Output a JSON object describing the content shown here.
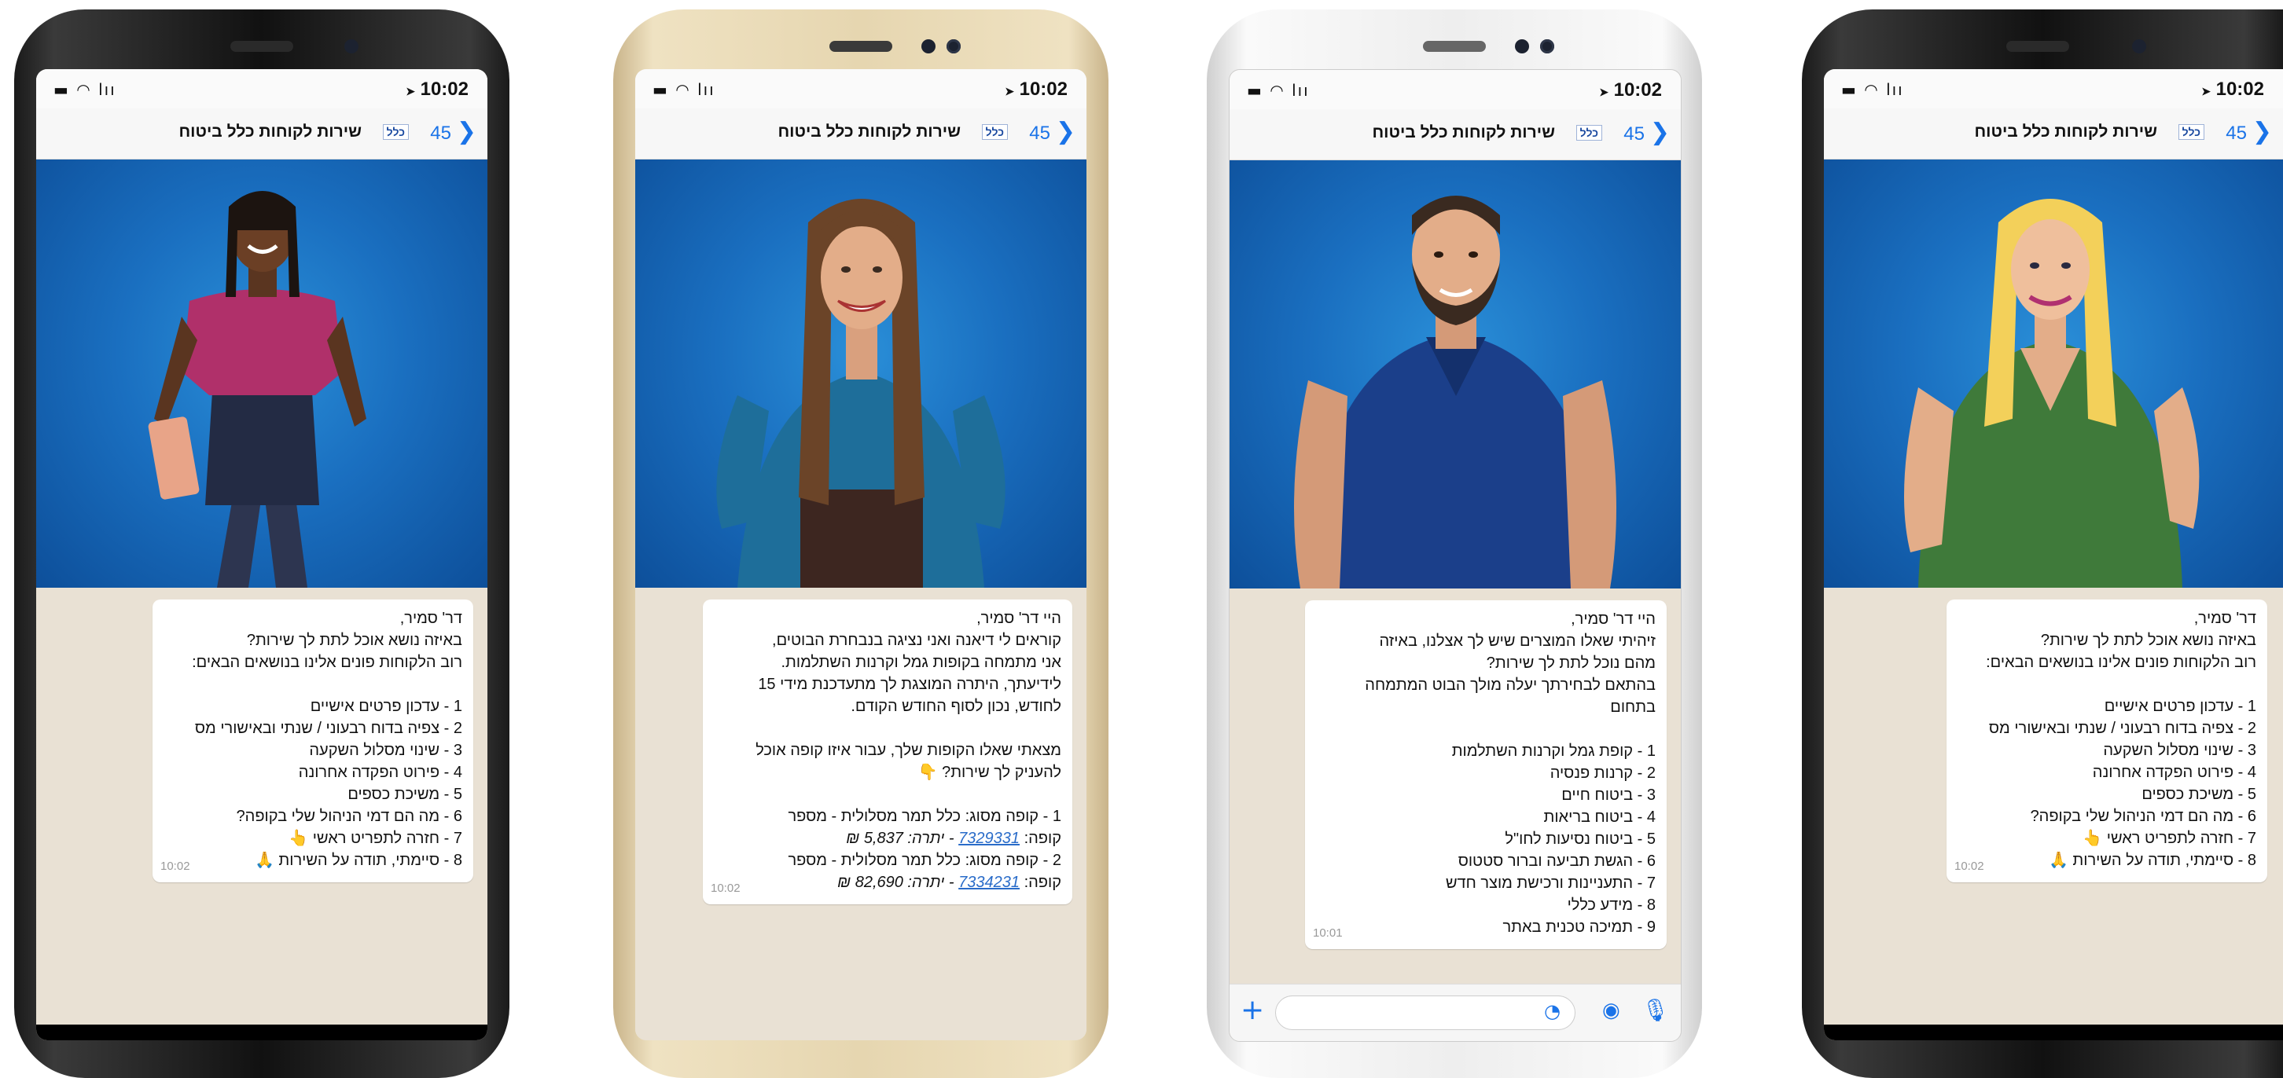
{
  "common": {
    "status_left": "▬ ◠ lıı",
    "time": "10:02",
    "location_arrow": "➤",
    "back_chevron": "❯",
    "unread_count": "45",
    "brand_logo": "כלל",
    "chat_title": "שירות לקוחות כלל ביטוח",
    "msg_time": "10:02",
    "msg_time_3": "10:01"
  },
  "phone1": {
    "lines": [
      "דר' סמיר,",
      "באיזה נושא אוכל לתת לך שירות?",
      "רוב הלקוחות פונים אלינו בנושאים הבאים:",
      "",
      "1 - עדכון פרטים אישיים",
      "2 - צפיה בדוח רבעוני / שנתי ובאישורי מס",
      "3 - שינוי מסלול השקעה",
      "4 - פירוט הפקדה אחרונה",
      "5 - משיכת כספים",
      "6 - מה הם דמי הניהול שלי בקופה?",
      "7 - חזרה לתפריט ראשי 👆",
      "8 - סיימתי, תודה על השירות 🙏"
    ]
  },
  "phone2": {
    "lines": [
      "היי דר' סמיר,",
      "קוראים לי דיאנה ואני נציגה בנבחרת הבוטים,",
      "אני מתמחה בקופות גמל וקרנות השתלמות.",
      "לידיעתך, היתרה המוצגת לך מתעדכנת מידי 15",
      "לחודש, נכון לסוף החודש הקודם.",
      "",
      "מצאתי שאלו הקופות שלך, עבור איזו קופה אוכל",
      "להעניק לך שירות? 👇",
      ""
    ],
    "fund1_line1": "1 - קופה מסוג: כלל תמר מסלולית - מספר",
    "fund1_prefix": "קופה: ",
    "fund1_number": "7329331",
    "fund1_balance": " - יתרה: 5,837 ₪",
    "fund2_line1": "2 - קופה מסוג: כלל תמר מסלולית - מספר",
    "fund2_prefix": "קופה: ",
    "fund2_number": "7334231",
    "fund2_balance": " - יתרה: 82,690 ₪"
  },
  "phone3": {
    "lines": [
      "היי דר' סמיר,",
      "זיהיתי שאלו המוצרים שיש לך אצלנו, באיזה",
      "מהם נוכל לתת לך שירות?",
      "בהתאם לבחירתך יעלה מולך הבוט המתמחה",
      "בתחום",
      "",
      "1 - קופת גמל וקרנות השתלמות",
      "2 - קרנות פנסיה",
      "3 - ביטוח חיים",
      "4 - ביטוח בריאות",
      "5 - ביטוח נסיעות לחו\"ל",
      "6 - הגשת תביעה וברור סטטוס",
      "7 - התעניינות ורכישת מוצר חדש",
      "8 - מידע כללי",
      "9 - תמיכה טכנית באתר"
    ],
    "composer_plus": "+",
    "composer_sticker": "◔",
    "composer_camera": "◉",
    "composer_mic": "🎙"
  },
  "phone4": {
    "lines": [
      "דר' סמיר,",
      "באיזה נושא אוכל לתת לך שירות?",
      "רוב הלקוחות פונים אלינו בנושאים הבאים:",
      "",
      "1 - עדכון פרטים אישיים",
      "2 - צפיה בדוח רבעוני / שנתי ובאישורי מס",
      "3 - שינוי מסלול השקעה",
      "4 - פירוט הפקדה אחרונה",
      "5 - משיכת כספים",
      "6 - מה הם דמי הניהול שלי בקופה?",
      "7 - חזרה לתפריט ראשי 👆",
      "8 - סיימתי, תודה על השירות 🙏"
    ]
  },
  "colors": {
    "accent": "#1a73e8",
    "avatar_bg": "#1a6fc0",
    "chat_bg": "#e9e1d4"
  }
}
